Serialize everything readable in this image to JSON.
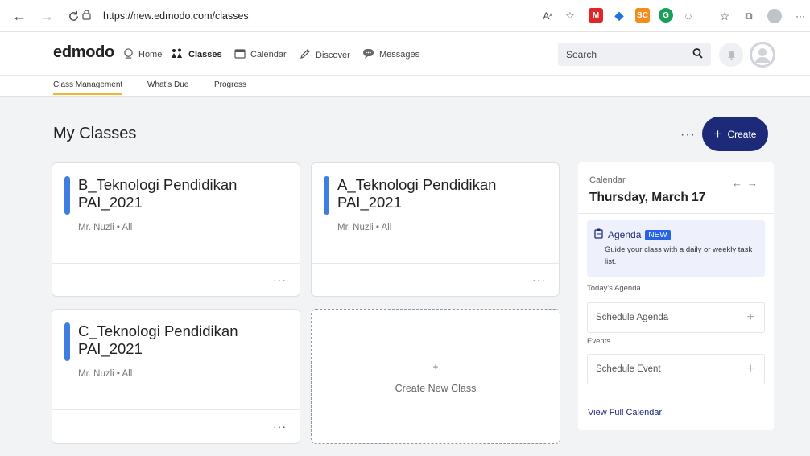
{
  "browser": {
    "url": "https://new.edmodo.com/classes"
  },
  "navbar": {
    "logo": "edmodo",
    "items": [
      {
        "label": "Home",
        "icon": "home-icon"
      },
      {
        "label": "Classes",
        "icon": "classes-icon"
      },
      {
        "label": "Calendar",
        "icon": "calendar-icon"
      },
      {
        "label": "Discover",
        "icon": "discover-icon"
      },
      {
        "label": "Messages",
        "icon": "messages-icon"
      }
    ],
    "search_placeholder": "Search"
  },
  "subnav": {
    "tabs": [
      {
        "label": "Class Management",
        "active": true
      },
      {
        "label": "What's Due",
        "active": false
      },
      {
        "label": "Progress",
        "active": false
      }
    ]
  },
  "main": {
    "title": "My Classes",
    "create_label": "Create",
    "classes": [
      {
        "name": "B_Teknologi Pendidikan PAI_2021",
        "meta": "Mr. Nuzli • All",
        "color": "#3d7ee0"
      },
      {
        "name": "A_Teknologi Pendidikan PAI_2021",
        "meta": "Mr. Nuzli • All",
        "color": "#3d7ee0"
      },
      {
        "name": "C_Teknologi Pendidikan PAI_2021",
        "meta": "Mr. Nuzli • All",
        "color": "#3d7ee0"
      }
    ],
    "new_class_label": "Create New Class"
  },
  "calendar": {
    "label": "Calendar",
    "date": "Thursday, March 17",
    "agenda_title": "Agenda",
    "agenda_badge": "NEW",
    "agenda_desc": "Guide your class with a daily or weekly task list.",
    "todays_agenda": "Today's Agenda",
    "schedule_agenda": "Schedule Agenda",
    "events": "Events",
    "schedule_event": "Schedule Event",
    "view_full": "View Full Calendar"
  },
  "colors": {
    "brand": "#1d2a7a",
    "accent_tab": "#f2b631",
    "class_bar": "#3d7ee0"
  }
}
